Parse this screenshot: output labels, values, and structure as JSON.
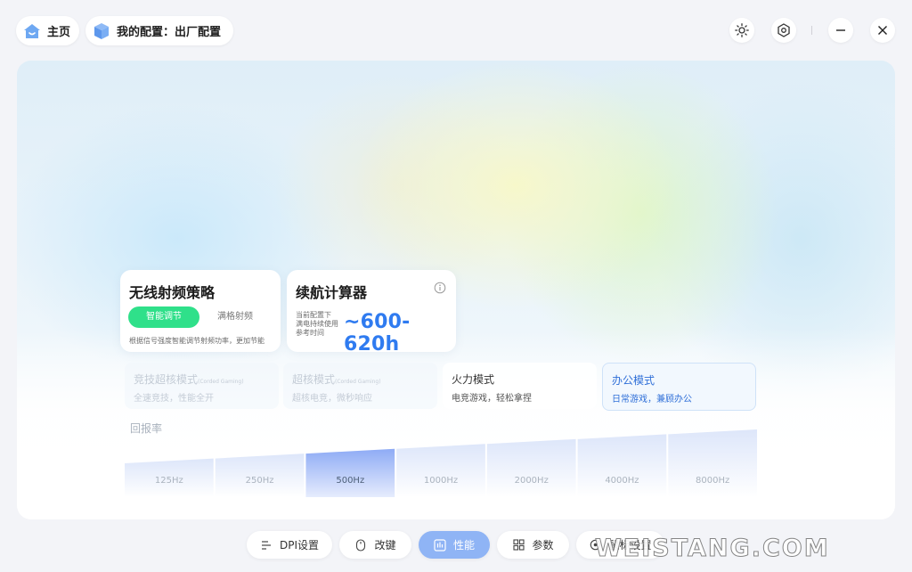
{
  "header": {
    "home_label": "主页",
    "config_label": "我的配置：出厂配置"
  },
  "rf_card": {
    "title": "无线射频策略",
    "option_active": "智能调节",
    "option_inactive": "满格射频",
    "description": "根据信号强度智能调节射频功率，更加节能"
  },
  "battery_card": {
    "title": "续航计算器",
    "label_lines": [
      "当前配置下",
      "满电持续使用",
      "参考时间"
    ],
    "value": "~600-620h"
  },
  "modes": [
    {
      "title": "竞技超核模式",
      "tag": "(Corded Gaming)",
      "desc": "全速竞技，性能全开"
    },
    {
      "title": "超核模式",
      "tag": "(Corded Gaming)",
      "desc": "超核电竞，微秒响应"
    },
    {
      "title": "火力模式",
      "tag": "",
      "desc": "电竞游戏，轻松拿捏"
    },
    {
      "title": "办公模式",
      "tag": "",
      "desc": "日常游戏，兼顾办公"
    }
  ],
  "polling": {
    "label": "回报率",
    "options": [
      "125Hz",
      "250Hz",
      "500Hz",
      "1000Hz",
      "2000Hz",
      "4000Hz",
      "8000Hz"
    ],
    "selected": "500Hz"
  },
  "bottom_nav": {
    "dpi": "DPI设置",
    "keys": "改键",
    "performance": "性能",
    "params": "参数",
    "mouse": "鼠标设置"
  },
  "watermark": "WEISTANG.COM",
  "colors": {
    "accent_green": "#2fe08a",
    "accent_blue": "#2f7bf0",
    "nav_active": "#8fb4f5"
  }
}
